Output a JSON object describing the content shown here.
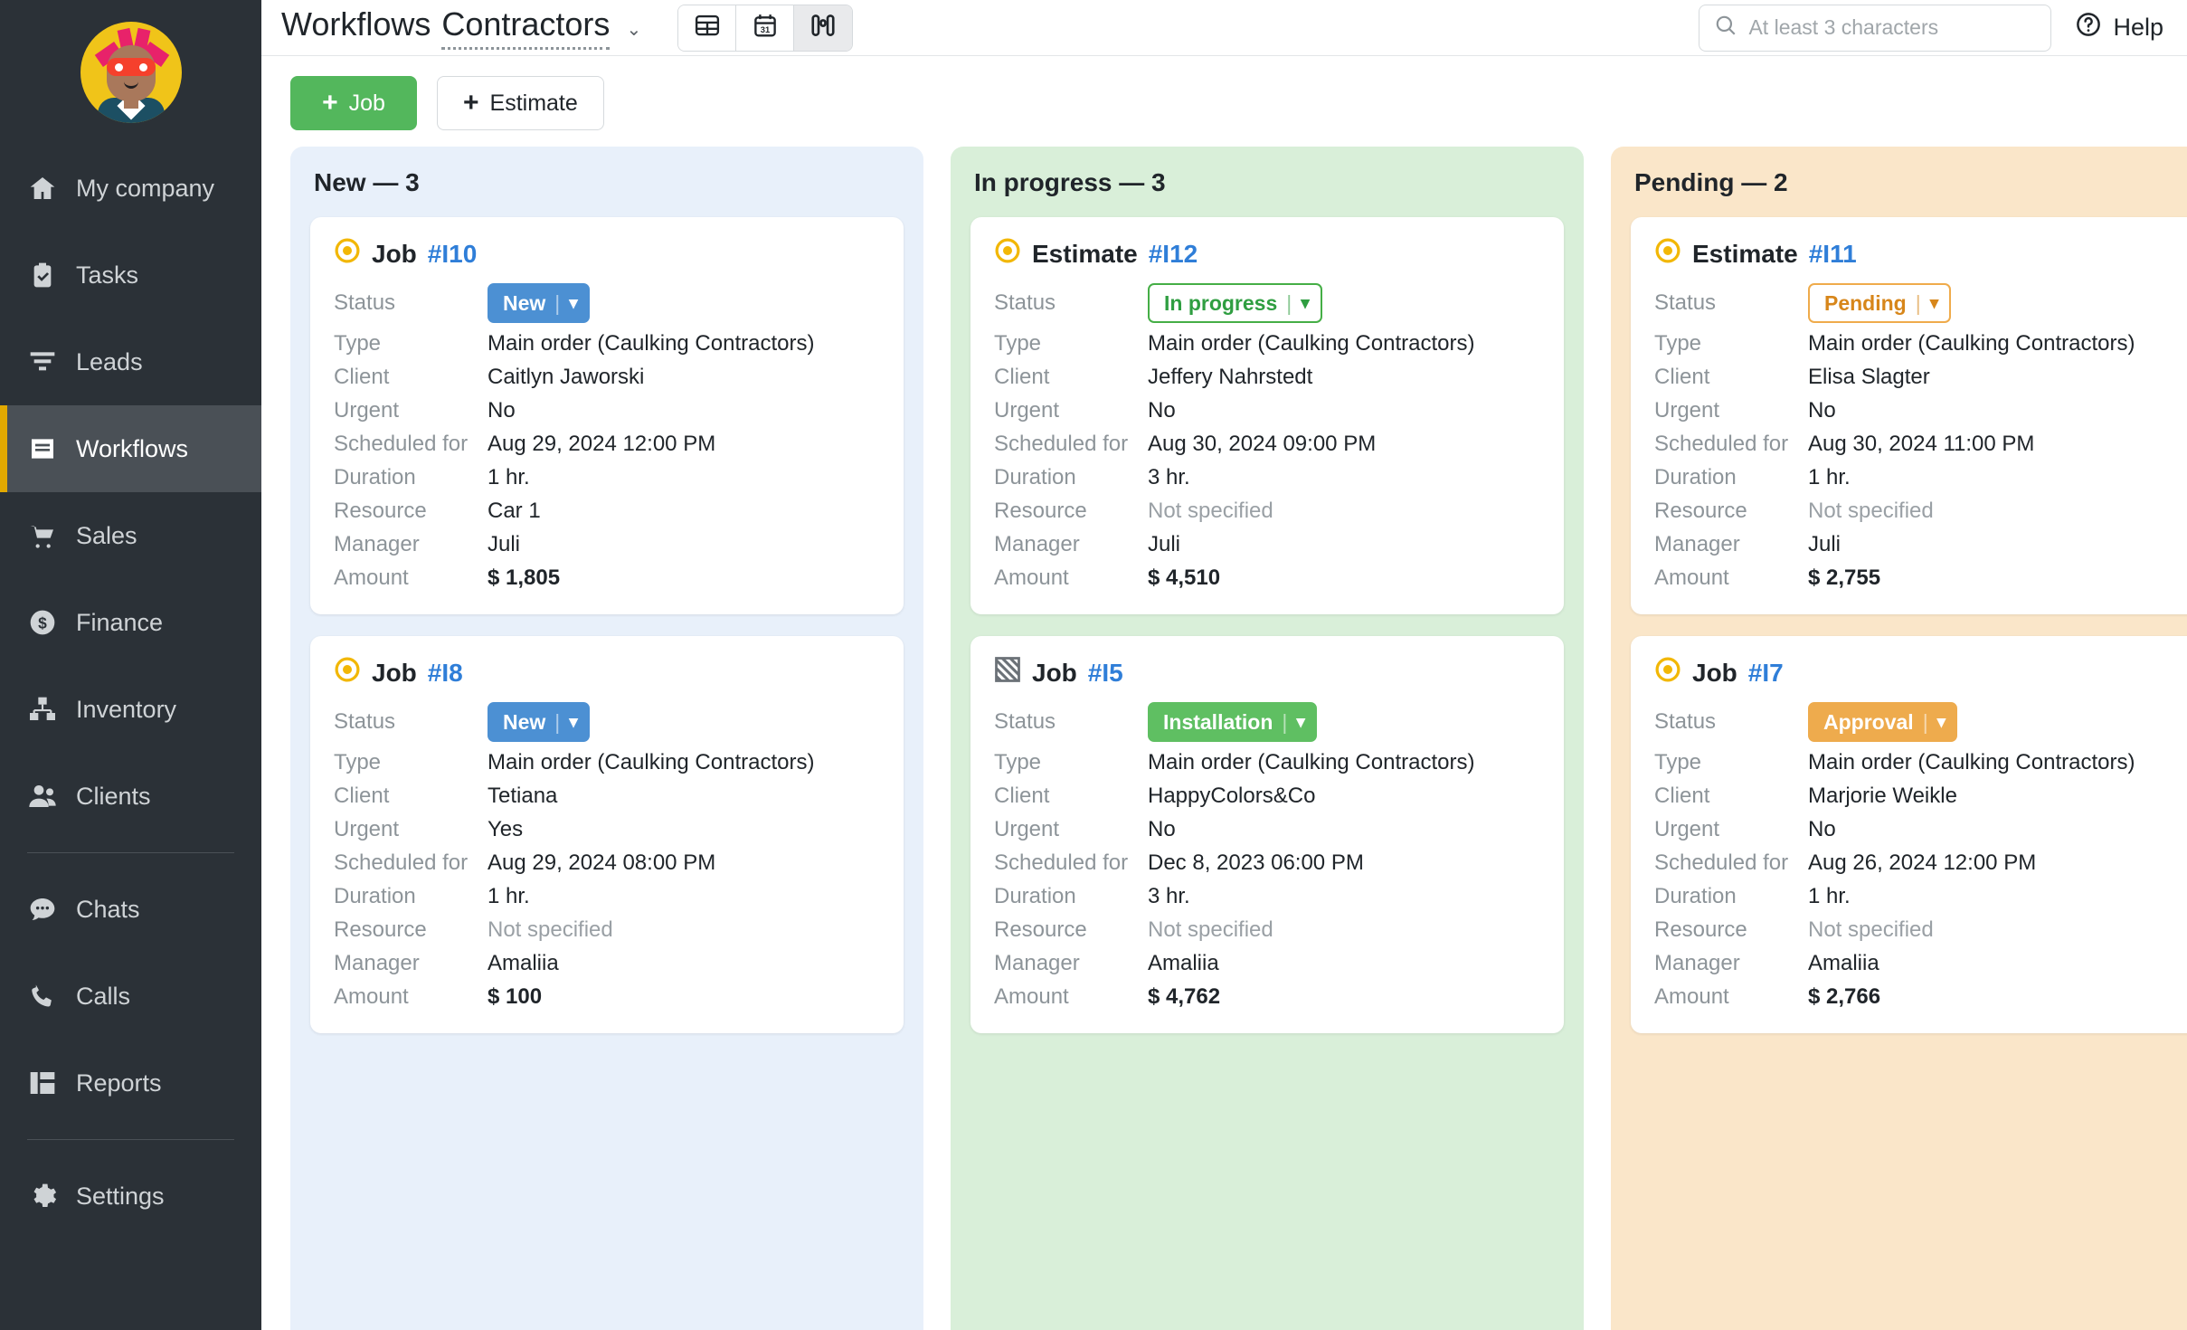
{
  "sidebar": {
    "avatar_name": "user-avatar",
    "items": [
      {
        "label": "My company",
        "icon": "home-icon",
        "active": false
      },
      {
        "label": "Tasks",
        "icon": "clipboard-check-icon",
        "active": false
      },
      {
        "label": "Leads",
        "icon": "funnel-icon",
        "active": false
      },
      {
        "label": "Workflows",
        "icon": "workflows-icon",
        "active": true
      },
      {
        "label": "Sales",
        "icon": "cart-icon",
        "active": false
      },
      {
        "label": "Finance",
        "icon": "dollar-circle-icon",
        "active": false
      },
      {
        "label": "Inventory",
        "icon": "boxes-icon",
        "active": false
      },
      {
        "label": "Clients",
        "icon": "people-icon",
        "active": false
      },
      {
        "label": "Chats",
        "icon": "chat-bubble-icon",
        "active": false
      },
      {
        "label": "Calls",
        "icon": "phone-icon",
        "active": false
      },
      {
        "label": "Reports",
        "icon": "reports-grid-icon",
        "active": false
      },
      {
        "label": "Settings",
        "icon": "gear-icon",
        "active": false
      }
    ],
    "accent_color": "#e2a900",
    "background": "#2b3137"
  },
  "topbar": {
    "title": "Workflows",
    "context": "Contractors",
    "caret": "⌄",
    "views": [
      {
        "name": "table-view",
        "icon": "table-icon",
        "active": false
      },
      {
        "name": "calendar-view",
        "icon": "calendar-icon",
        "active": false
      },
      {
        "name": "kanban-view",
        "icon": "kanban-icon",
        "active": true
      }
    ],
    "search_placeholder": "At least 3 characters",
    "search_value": "",
    "help_label": "Help"
  },
  "actions": {
    "job_label": "Job",
    "estimate_label": "Estimate",
    "plus": "+"
  },
  "labels": {
    "status": "Status",
    "type": "Type",
    "client": "Client",
    "urgent": "Urgent",
    "scheduled": "Scheduled for",
    "duration": "Duration",
    "resource": "Resource",
    "manager": "Manager",
    "amount": "Amount"
  },
  "columns": [
    {
      "title": "New — 3",
      "name": "column-new",
      "bg": "#e8f0fa",
      "cards": [
        {
          "kind": "Job",
          "id": "#I10",
          "icon": "target-dot-icon",
          "status": {
            "text": "New",
            "style": "pill-blue"
          },
          "type": "Main order (Caulking Contractors)",
          "client": "Caitlyn Jaworski",
          "urgent": "No",
          "scheduled": "Aug 29, 2024 12:00 PM",
          "duration": "1 hr.",
          "resource": "Car 1",
          "resource_muted": false,
          "manager": "Juli",
          "amount": "$ 1,805"
        },
        {
          "kind": "Job",
          "id": "#I8",
          "icon": "target-dot-icon",
          "status": {
            "text": "New",
            "style": "pill-blue"
          },
          "type": "Main order (Caulking Contractors)",
          "client": "Tetiana",
          "urgent": "Yes",
          "scheduled": "Aug 29, 2024 08:00 PM",
          "duration": "1 hr.",
          "resource": "Not specified",
          "resource_muted": true,
          "manager": "Amaliia",
          "amount": "$ 100"
        }
      ]
    },
    {
      "title": "In progress — 3",
      "name": "column-in-progress",
      "bg": "#d9efd9",
      "cards": [
        {
          "kind": "Estimate",
          "id": "#I12",
          "icon": "target-dot-icon",
          "status": {
            "text": "In progress",
            "style": "pill-outline-green"
          },
          "type": "Main order (Caulking Contractors)",
          "client": "Jeffery Nahrstedt",
          "urgent": "No",
          "scheduled": "Aug 30, 2024 09:00 PM",
          "duration": "3 hr.",
          "resource": "Not specified",
          "resource_muted": true,
          "manager": "Juli",
          "amount": "$ 4,510"
        },
        {
          "kind": "Job",
          "id": "#I5",
          "icon": "hatched-square-icon",
          "status": {
            "text": "Installation",
            "style": "pill-green"
          },
          "type": "Main order (Caulking Contractors)",
          "client": "HappyColors&Co",
          "urgent": "No",
          "scheduled": "Dec 8, 2023 06:00 PM",
          "duration": "3 hr.",
          "resource": "Not specified",
          "resource_muted": true,
          "manager": "Amaliia",
          "amount": "$ 4,762"
        }
      ]
    },
    {
      "title": "Pending — 2",
      "name": "column-pending",
      "bg": "#fae6c9",
      "cards": [
        {
          "kind": "Estimate",
          "id": "#I11",
          "icon": "target-dot-icon",
          "status": {
            "text": "Pending",
            "style": "pill-outline-amber"
          },
          "type": "Main order (Caulking Contractors)",
          "client": "Elisa Slagter",
          "urgent": "No",
          "scheduled": "Aug 30, 2024 11:00 PM",
          "duration": "1 hr.",
          "resource": "Not specified",
          "resource_muted": true,
          "manager": "Juli",
          "amount": "$ 2,755"
        },
        {
          "kind": "Job",
          "id": "#I7",
          "icon": "target-dot-icon",
          "status": {
            "text": "Approval",
            "style": "pill-amber"
          },
          "type": "Main order (Caulking Contractors)",
          "client": "Marjorie Weikle",
          "urgent": "No",
          "scheduled": "Aug 26, 2024 12:00 PM",
          "duration": "1 hr.",
          "resource": "Not specified",
          "resource_muted": true,
          "manager": "Amaliia",
          "amount": "$ 2,766"
        }
      ]
    }
  ]
}
